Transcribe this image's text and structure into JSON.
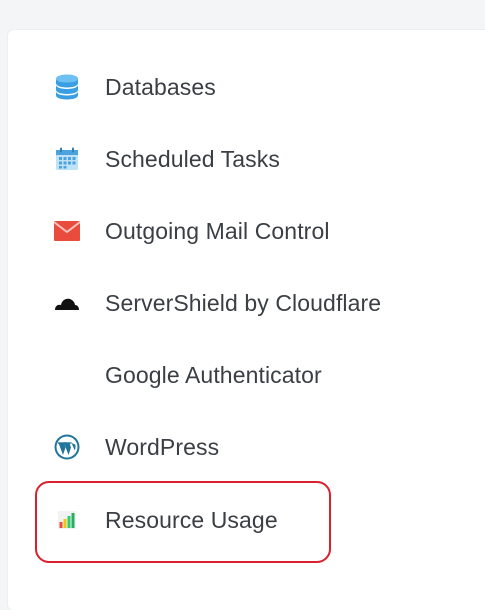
{
  "menu": {
    "items": [
      {
        "label": "Databases",
        "icon": "database-icon"
      },
      {
        "label": "Scheduled Tasks",
        "icon": "calendar-icon"
      },
      {
        "label": "Outgoing Mail Control",
        "icon": "envelope-icon"
      },
      {
        "label": "ServerShield by Cloudflare",
        "icon": "cloud-icon"
      },
      {
        "label": "Google Authenticator",
        "icon": ""
      },
      {
        "label": "WordPress",
        "icon": "wordpress-icon"
      },
      {
        "label": "Resource Usage",
        "icon": "bar-chart-icon"
      }
    ]
  },
  "colors": {
    "highlight": "#d8212c",
    "database": "#3a9ee4",
    "calendar": "#4aa3df",
    "envelope": "#e94b3c",
    "wordpress": "#21759b"
  }
}
